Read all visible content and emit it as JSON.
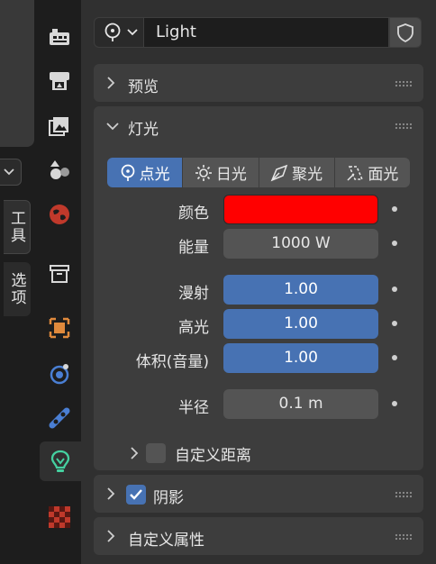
{
  "sidebar_tabs": {
    "tool": "工具",
    "options": "选项"
  },
  "header": {
    "datablock_name": "Light"
  },
  "panels": {
    "preview": {
      "title": "预览"
    },
    "light": {
      "title": "灯光",
      "types": [
        {
          "label": "点光",
          "icon": "point-light-icon",
          "active": true
        },
        {
          "label": "日光",
          "icon": "sun-light-icon",
          "active": false
        },
        {
          "label": "聚光",
          "icon": "spot-light-icon",
          "active": false
        },
        {
          "label": "面光",
          "icon": "area-light-icon",
          "active": false
        }
      ],
      "color": {
        "label": "颜色",
        "value": "#ff0000"
      },
      "energy": {
        "label": "能量",
        "value": "1000 W"
      },
      "diffuse": {
        "label": "漫射",
        "value": "1.00"
      },
      "specular": {
        "label": "高光",
        "value": "1.00"
      },
      "volume": {
        "label": "体积(音量)",
        "value": "1.00"
      },
      "radius": {
        "label": "半径",
        "value": "0.1 m"
      },
      "custom_distance": {
        "label": "自定义距离",
        "checked": false
      }
    },
    "shadow": {
      "title": "阴影",
      "checked": true
    },
    "custom_props": {
      "title": "自定义属性"
    }
  },
  "colors": {
    "accent": "#4772b3",
    "panel": "#3d3d3d",
    "field": "#545454",
    "background": "#303030"
  }
}
